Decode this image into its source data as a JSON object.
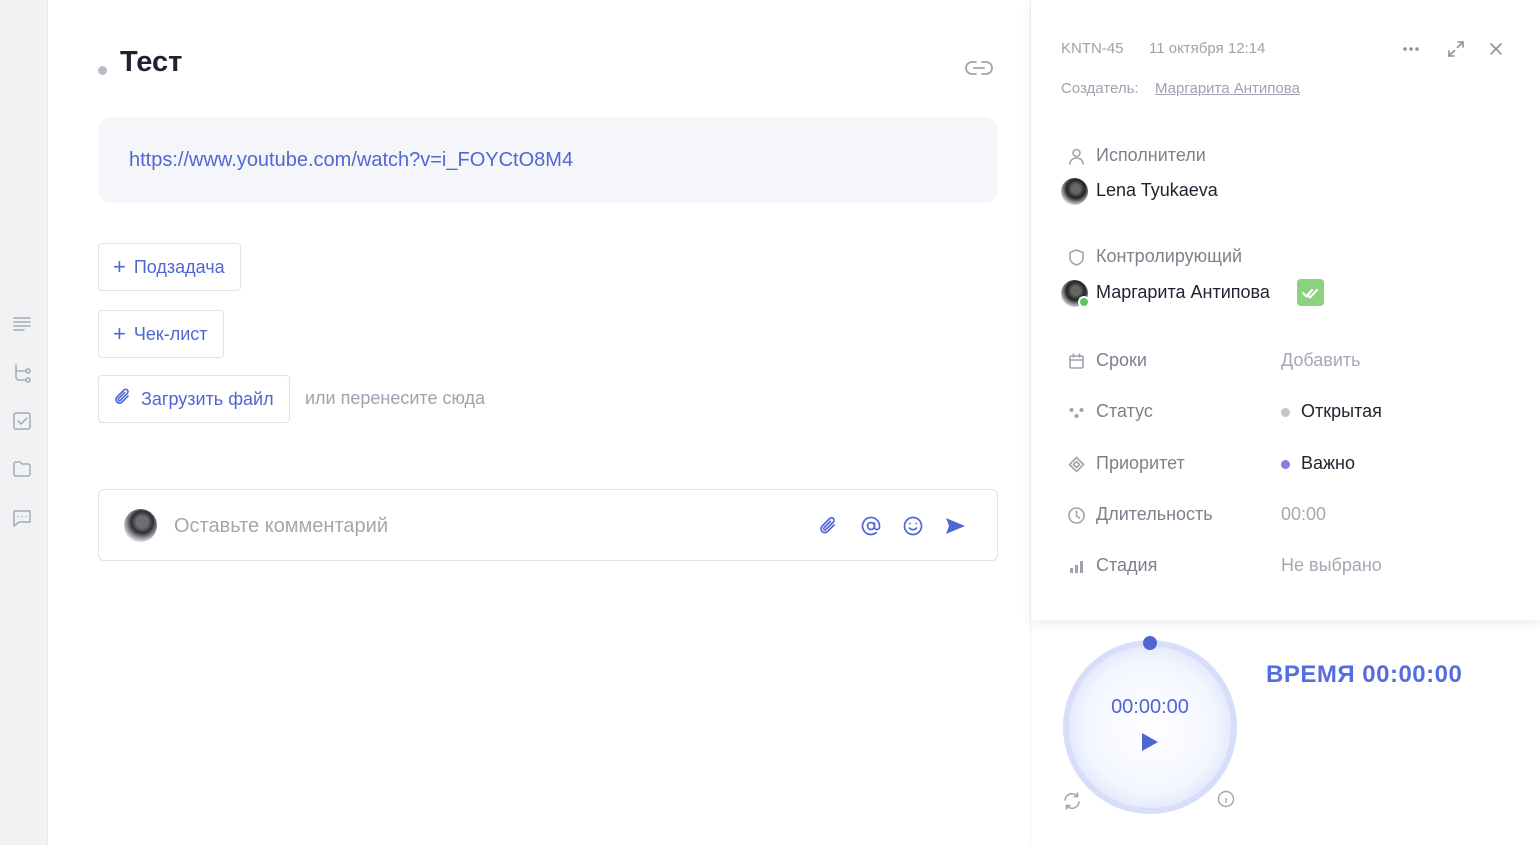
{
  "task": {
    "title": "Тест",
    "description_link": "https://www.youtube.com/watch?v=i_FOYCtO8M4"
  },
  "actions": {
    "subtask_label": "Подзадача",
    "checklist_label": "Чек-лист",
    "upload_label": "Загрузить файл",
    "drop_hint": "или перенесите сюда"
  },
  "comment": {
    "placeholder": "Оставьте комментарий"
  },
  "side": {
    "code": "KNTN-45",
    "date": "11 октября 12:14",
    "creator_label": "Создатель:",
    "creator_name": "Маргарита Антипова",
    "assignees_label": "Исполнители",
    "assignee_name": "Lena Tyukaeva",
    "controller_label": "Контролирующий",
    "controller_name": "Маргарита Антипова",
    "fields": {
      "deadline_label": "Сроки",
      "deadline_value": "Добавить",
      "status_label": "Статус",
      "status_value": "Открытая",
      "priority_label": "Приоритет",
      "priority_value": "Важно",
      "duration_label": "Длительность",
      "duration_value": "00:00",
      "stage_label": "Стадия",
      "stage_value": "Не выбрано"
    },
    "colors": {
      "status_dot": "#c4c6cc",
      "priority_dot": "#8e79e8",
      "accent": "#4f66d2"
    }
  },
  "timer": {
    "display": "00:00:00",
    "label": "ВРЕМЯ 00:00:00"
  },
  "icons": {
    "rail": [
      "description-icon",
      "subtask-tree-icon",
      "checklist-icon",
      "folder-icon",
      "comments-icon"
    ]
  }
}
